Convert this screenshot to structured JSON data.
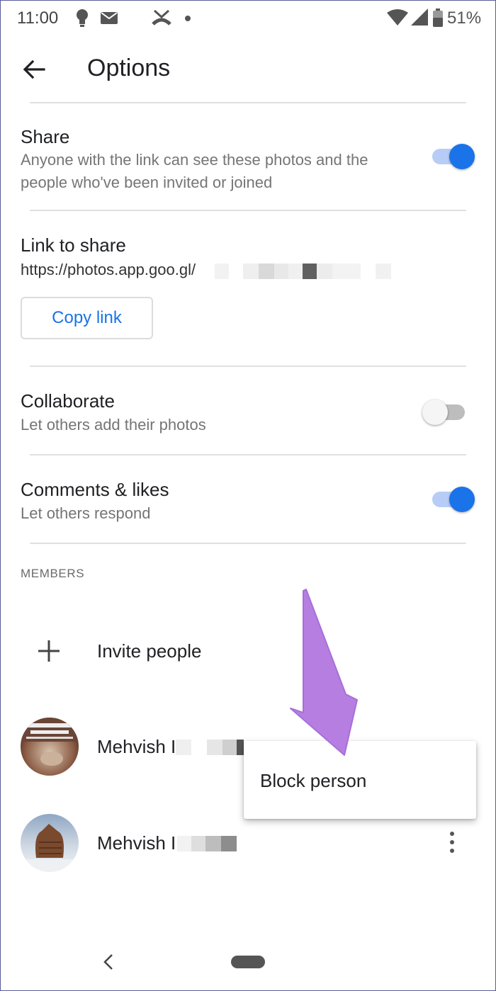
{
  "status_bar": {
    "time": "11:00",
    "battery": "51%"
  },
  "header": {
    "title": "Options"
  },
  "share": {
    "title": "Share",
    "subtitle": "Anyone with the link can see these photos and the people who've been invited or joined",
    "enabled": true
  },
  "link": {
    "title": "Link to share",
    "url": "https://photos.app.goo.gl/",
    "copy_label": "Copy link"
  },
  "collaborate": {
    "title": "Collaborate",
    "subtitle": "Let others add their photos",
    "enabled": false
  },
  "comments": {
    "title": "Comments & likes",
    "subtitle": "Let others respond",
    "enabled": true
  },
  "members": {
    "header": "MEMBERS",
    "invite_label": "Invite people",
    "list": [
      {
        "name": "Mehvish I"
      },
      {
        "name": "Mehvish I"
      }
    ]
  },
  "popup_menu": {
    "items": [
      "Block person"
    ]
  },
  "colors": {
    "accent": "#1a73e8",
    "annotation_arrow": "#b57ee0"
  }
}
